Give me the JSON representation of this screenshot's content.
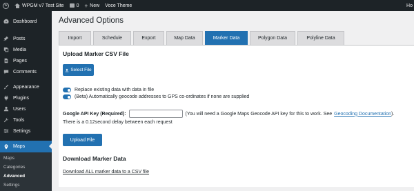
{
  "adminbar": {
    "site_name": "WPGM v7 Test Site",
    "comments_count": "0",
    "new_label": "New",
    "theme_label": "Voce Theme",
    "user_label": "Ho"
  },
  "sidebar": {
    "items": [
      {
        "label": "Dashboard",
        "icon": "dashboard-icon"
      },
      {
        "label": "Posts",
        "icon": "pin-icon"
      },
      {
        "label": "Media",
        "icon": "media-icon"
      },
      {
        "label": "Pages",
        "icon": "page-icon"
      },
      {
        "label": "Comments",
        "icon": "comment-icon"
      },
      {
        "label": "Appearance",
        "icon": "brush-icon"
      },
      {
        "label": "Plugins",
        "icon": "plugin-icon"
      },
      {
        "label": "Users",
        "icon": "user-icon"
      },
      {
        "label": "Tools",
        "icon": "wrench-icon"
      },
      {
        "label": "Settings",
        "icon": "settings-icon"
      },
      {
        "label": "Maps",
        "icon": "map-pin-icon"
      }
    ],
    "submenu": [
      "Maps",
      "Categories",
      "Advanced",
      "Settings"
    ],
    "active_submenu": "Advanced"
  },
  "page": {
    "title": "Advanced Options",
    "tabs": [
      "Import",
      "Schedule",
      "Export",
      "Map Data",
      "Marker Data",
      "Polygon Data",
      "Polyline Data"
    ],
    "active_tab": "Marker Data"
  },
  "upload": {
    "heading": "Upload Marker CSV File",
    "select_button": "Select File",
    "option_replace": "Replace existing data with data in file",
    "option_geocode": "(Beta) Automatically geocode addresses to GPS co-ordinates if none are supplied",
    "api_key_label": "Google API Key (Required):",
    "api_key_value": "",
    "api_note_prefix": "(You will need a Google Maps Geocode API key for this to work. See",
    "api_note_link": "Geocoding Documentation",
    "api_note_suffix": ").",
    "delay_note": "There is a 0.12second delay between each request",
    "upload_button": "Upload File"
  },
  "download": {
    "heading": "Download Marker Data",
    "link": "Download ALL marker data to a CSV file"
  },
  "colors": {
    "accent": "#2271b1",
    "admin_dark": "#1d2327",
    "background": "#f0f0f1"
  }
}
